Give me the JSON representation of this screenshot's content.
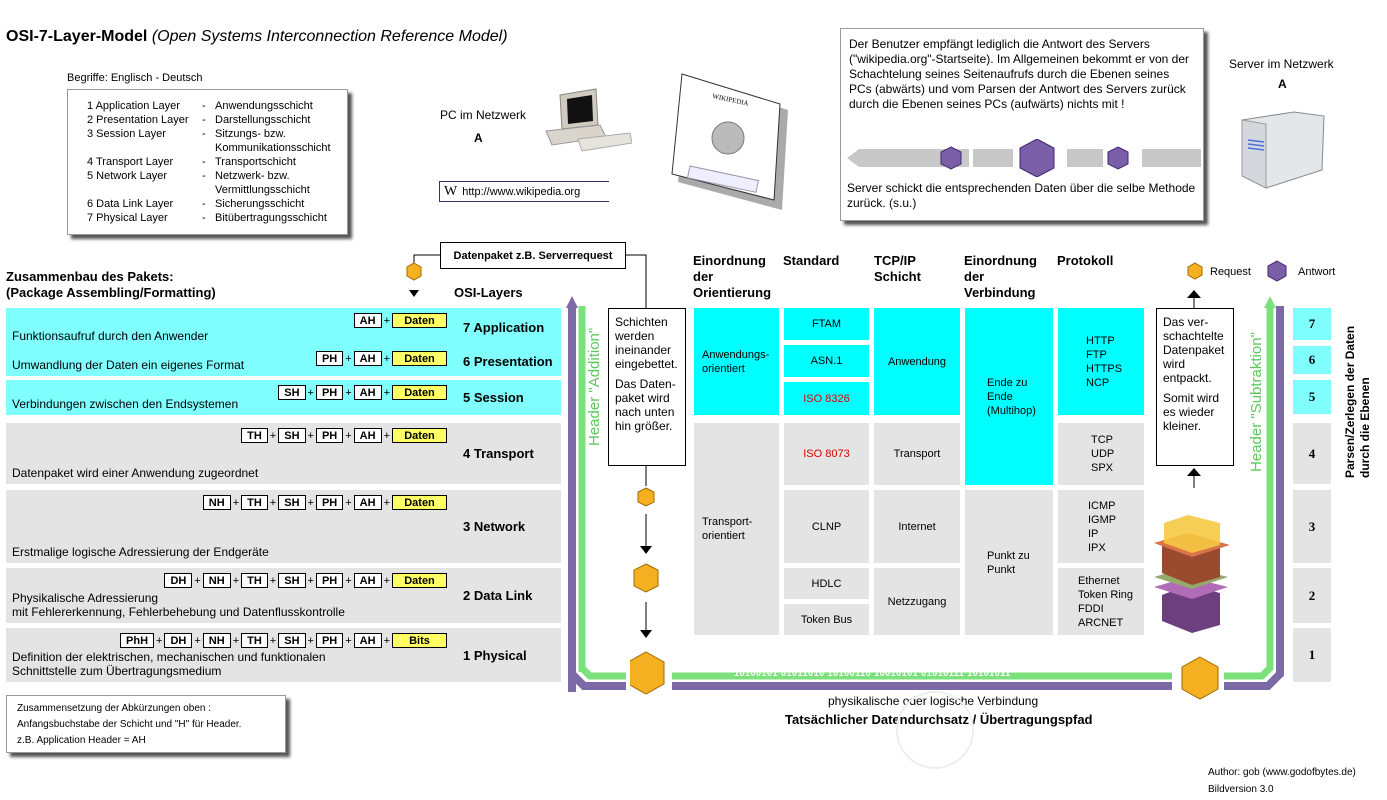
{
  "title": {
    "main": "OSI-7-Layer-Model",
    "sub": "(Open Systems Interconnection Reference Model)"
  },
  "glossary": {
    "heading": "Begriffe: Englisch - Deutsch",
    "items": [
      {
        "en": "1 Application Layer",
        "de": "Anwendungsschicht"
      },
      {
        "en": "2 Presentation Layer",
        "de": "Darstellungsschicht"
      },
      {
        "en": "3 Session Layer",
        "de": "Sitzungs- bzw.",
        "de2": "Kommunikationsschicht"
      },
      {
        "en": "4 Transport Layer",
        "de": "Transportschicht"
      },
      {
        "en": "5 Network Layer",
        "de": "Netzwerk- bzw.",
        "de2": "Vermittlungsschicht"
      },
      {
        "en": "6 Data Link Layer",
        "de": "Sicherungsschicht"
      },
      {
        "en": "7 Physical Layer",
        "de": "Bitübertragungsschicht"
      }
    ]
  },
  "pc": {
    "label": "PC im Netzwerk",
    "letter": "A",
    "url": "http://www.wikipedia.org",
    "url_icon": "W"
  },
  "server": {
    "label": "Server im Netzwerk",
    "letter": "A"
  },
  "info_box": {
    "text": "Der Benutzer empfängt lediglich die Antwort des Servers (\"wikipedia.org\"-Startseite). Im Allgemeinen bekommt er von der Schachtelung seines Seitenaufrufs durch die Ebenen seines PCs (abwärts) und vom Parsen der Antwort des Servers zurück durch die Ebenen seines PCs (aufwärts) nichts mit !",
    "footer": "Server schickt die entsprechenden Daten über die selbe Methode zurück. (s.u.)"
  },
  "legend": {
    "request": "Request",
    "response": "Antwort",
    "request_color": "#f5b021",
    "response_color": "#7a5ea8"
  },
  "packet_label": "Datenpaket z.B. Serverrequest",
  "assembly": {
    "heading1": "Zusammenbau des Pakets:",
    "heading2": "(Package Assembling/Formatting)"
  },
  "osi_heading": "OSI-Layers",
  "layers": [
    {
      "name": "7 Application",
      "desc": [
        "Funktionsaufruf durch den Anwender"
      ],
      "headers": [
        "AH"
      ],
      "payload": "Daten"
    },
    {
      "name": "6 Presentation",
      "desc": [
        "Umwandlung der Daten ein eigenes Format"
      ],
      "headers": [
        "PH",
        "AH"
      ],
      "payload": "Daten"
    },
    {
      "name": "5 Session",
      "desc": [
        "Verbindungen zwischen den Endsystemen"
      ],
      "headers": [
        "SH",
        "PH",
        "AH"
      ],
      "payload": "Daten"
    },
    {
      "name": "4 Transport",
      "desc": [
        "Datenpaket wird einer Anwendung zugeordnet"
      ],
      "headers": [
        "TH",
        "SH",
        "PH",
        "AH"
      ],
      "payload": "Daten"
    },
    {
      "name": "3 Network",
      "desc": [
        "Erstmalige logische Adressierung der Endgeräte"
      ],
      "headers": [
        "NH",
        "TH",
        "SH",
        "PH",
        "AH"
      ],
      "payload": "Daten"
    },
    {
      "name": "2 Data Link",
      "desc": [
        "Physikalische Adressierung",
        "mit Fehlererkennung, Fehlerbehebung und Datenflusskontrolle"
      ],
      "headers": [
        "DH",
        "NH",
        "TH",
        "SH",
        "PH",
        "AH"
      ],
      "payload": "Daten"
    },
    {
      "name": "1 Physical",
      "desc": [
        "Definition der elektrischen, mechanischen und funktionalen",
        "Schnittstelle zum Übertragungsmedium"
      ],
      "headers": [
        "PhH",
        "DH",
        "NH",
        "TH",
        "SH",
        "PH",
        "AH"
      ],
      "payload": "Bits"
    }
  ],
  "addition_label": "Header \"Addition\"",
  "subtraction_label": "Header \"Subtraktion\"",
  "note_left": {
    "p1": "Schichten werden ineinander eingebettet.",
    "p2": "Das Daten-paket wird nach unten hin größer."
  },
  "note_right": {
    "p1": "Das ver-schachtelte Datenpaket wird entpackt.",
    "p2": "Somit wird es wieder kleiner."
  },
  "table": {
    "headers": {
      "orientation": "Einordnung der Orientierung",
      "standard": "Standard",
      "tcpip": "TCP/IP Schicht",
      "connection": "Einordnung der Verbindung",
      "protocol": "Protokoll"
    },
    "orientation": [
      "Anwendungs-orientiert",
      "Transport-orientiert"
    ],
    "standard": [
      "FTAM",
      "ASN.1",
      "ISO 8326",
      "ISO 8073",
      "CLNP",
      "HDLC",
      "Token Bus"
    ],
    "tcpip": [
      "Anwendung",
      "Transport",
      "Internet",
      "Netzzugang"
    ],
    "connection": [
      "Ende zu Ende (Multihop)",
      "Punkt zu Punkt"
    ],
    "protocol": [
      [
        "HTTP",
        "FTP",
        "HTTPS",
        "NCP"
      ],
      [
        "TCP",
        "UDP",
        "SPX"
      ],
      [
        "ICMP",
        "IGMP",
        "IP",
        "IPX"
      ],
      [
        "Ethernet",
        "Token Ring",
        "FDDI",
        "ARCNET"
      ]
    ]
  },
  "layer_numbers": [
    "7",
    "6",
    "5",
    "4",
    "3",
    "2",
    "1"
  ],
  "parse_label": {
    "line1": "Parsen/Zerlegen der Daten",
    "line2": "durch die Ebenen"
  },
  "bitstream": "10100101 01011010 10100110 10010101 01010111 10101011",
  "connection_caption": {
    "line1": "physikalische oder logische Verbindung",
    "line2": "Tatsächlicher Datendurchsatz / Übertragungspfad"
  },
  "abbrev_note": [
    "Zusammensetzung der Abkürzungen oben :",
    "Anfangsbuchstabe der Schicht und \"H\" für Header.",
    "z.B. Application Header = AH"
  ],
  "credits": {
    "author": "Author: gob (www.godofbytes.de)",
    "version": "Bildversion 3.0"
  }
}
